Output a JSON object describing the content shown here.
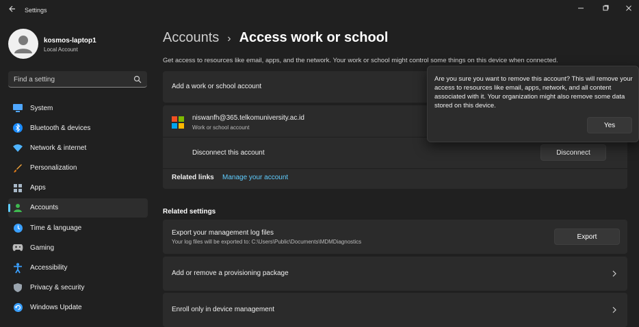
{
  "window": {
    "title": "Settings",
    "icons": {
      "back": "back-arrow-icon",
      "minimize": "minimize-icon",
      "maximize": "maximize-icon",
      "close": "close-icon"
    }
  },
  "profile": {
    "name": "kosmos-laptop1",
    "type": "Local Account"
  },
  "search": {
    "placeholder": "Find a setting"
  },
  "nav": {
    "items": [
      {
        "label": "System",
        "icon": "monitor-icon",
        "color": "#4fa7ff"
      },
      {
        "label": "Bluetooth & devices",
        "icon": "bluetooth-icon",
        "color": "#1a8cff"
      },
      {
        "label": "Network & internet",
        "icon": "wifi-icon",
        "color": "#4fb4ff"
      },
      {
        "label": "Personalization",
        "icon": "brush-icon",
        "color": "#f2a33a"
      },
      {
        "label": "Apps",
        "icon": "apps-icon",
        "color": "#a8b8c8"
      },
      {
        "label": "Accounts",
        "icon": "person-icon",
        "color": "#3fb950"
      },
      {
        "label": "Time & language",
        "icon": "globe-clock-icon",
        "color": "#3aa0ff"
      },
      {
        "label": "Gaming",
        "icon": "gamepad-icon",
        "color": "#b8b8b8"
      },
      {
        "label": "Accessibility",
        "icon": "accessibility-icon",
        "color": "#3aa0ff"
      },
      {
        "label": "Privacy & security",
        "icon": "shield-icon",
        "color": "#9aa4ae"
      },
      {
        "label": "Windows Update",
        "icon": "refresh-icon",
        "color": "#3aa0ff"
      }
    ],
    "active_index": 5
  },
  "breadcrumb": {
    "parent": "Accounts",
    "separator": "›",
    "current": "Access work or school"
  },
  "description": "Get access to resources like email, apps, and the network. Your work or school might control some things on this device when connected.",
  "add_account": {
    "title": "Add a work or school account"
  },
  "account": {
    "email": "niswanfh@365.telkomuniversity.ac.id",
    "type": "Work or school account",
    "disconnect_label": "Disconnect this account",
    "disconnect_button": "Disconnect",
    "related_links_label": "Related links",
    "manage_link": "Manage your account"
  },
  "related_settings": {
    "heading": "Related settings",
    "export": {
      "title": "Export your management log files",
      "subtitle": "Your log files will be exported to: C:\\Users\\Public\\Documents\\MDMDiagnostics",
      "button": "Export"
    },
    "provisioning": {
      "title": "Add or remove a provisioning package"
    },
    "enroll": {
      "title": "Enroll only in device management"
    }
  },
  "flyout": {
    "message": "Are you sure you want to remove this account? This will remove your access to resources like email, apps, network, and all content associated with it. Your organization might also remove some data stored on this device.",
    "confirm_button": "Yes"
  },
  "colors": {
    "accent": "#60cdff",
    "background": "#202020",
    "card": "#2b2b2b"
  }
}
